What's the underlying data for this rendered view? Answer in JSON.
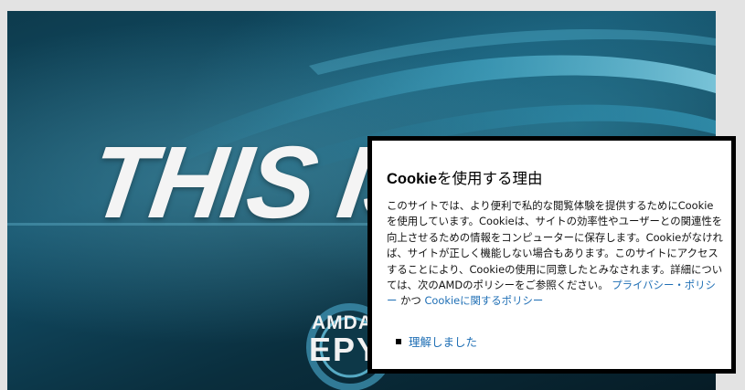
{
  "hero": {
    "headline": "THIS IS",
    "brand": "AMDA",
    "product": "EPY"
  },
  "cookie_dialog": {
    "title_cookie": "Cookie",
    "title_rest": "を使用する理由",
    "body_text": "このサイトでは、より便利で私的な閲覧体験を提供するためにCookieを使用しています。Cookieは、サイトの効率性やユーザーとの関連性を向上させるための情報をコンピューターに保存します。Cookieがなければ、サイトが正しく機能しない場合もあります。このサイトにアクセスすることにより、Cookieの使用に同意したとみなされます。詳細については、次のAMDのポリシーをご参照ください。",
    "privacy_link": "プライバシー・ポリシー",
    "conjunction": "かつ",
    "cookie_policy_link": "Cookieに関するポリシー",
    "acknowledge_label": "理解しました"
  },
  "colors": {
    "link": "#1f6fb5",
    "dialog_border": "#000000",
    "hero_dark": "#0a2e3d"
  }
}
